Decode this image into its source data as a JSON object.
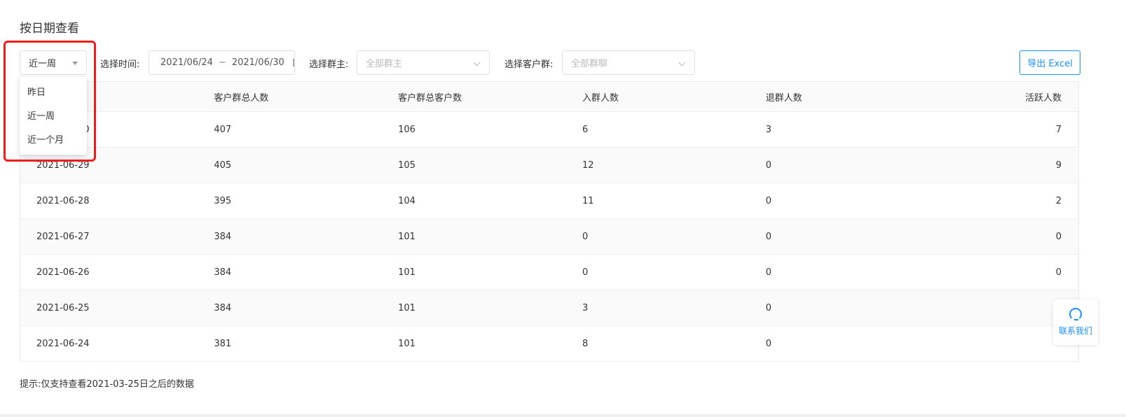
{
  "section_title": "按日期查看",
  "filters": {
    "period_value": "近一周",
    "period_options": [
      "昨日",
      "近一周",
      "近一个月"
    ],
    "time_label": "选择时间:",
    "date_start": "2021/06/24",
    "date_sep": "~",
    "date_end": "2021/06/30",
    "owner_label": "选择群主:",
    "owner_placeholder": "全部群主",
    "group_label": "选择客户群:",
    "group_placeholder": "全部群聊"
  },
  "export_label": "导出 Excel",
  "table": {
    "headers": [
      "",
      "客户群总人数",
      "客户群总客户数",
      "入群人数",
      "退群人数",
      "活跃人数"
    ],
    "rows": [
      [
        "2021-06-30",
        "407",
        "106",
        "6",
        "3",
        "7"
      ],
      [
        "2021-06-29",
        "405",
        "105",
        "12",
        "0",
        "9"
      ],
      [
        "2021-06-28",
        "395",
        "104",
        "11",
        "0",
        "2"
      ],
      [
        "2021-06-27",
        "384",
        "101",
        "0",
        "0",
        "0"
      ],
      [
        "2021-06-26",
        "384",
        "101",
        "0",
        "0",
        "0"
      ],
      [
        "2021-06-25",
        "384",
        "101",
        "3",
        "0",
        ""
      ],
      [
        "2021-06-24",
        "381",
        "101",
        "8",
        "0",
        ""
      ]
    ]
  },
  "tip": "提示:仅支持查看2021-03-25日之后的数据",
  "contact_label": "联系我们"
}
